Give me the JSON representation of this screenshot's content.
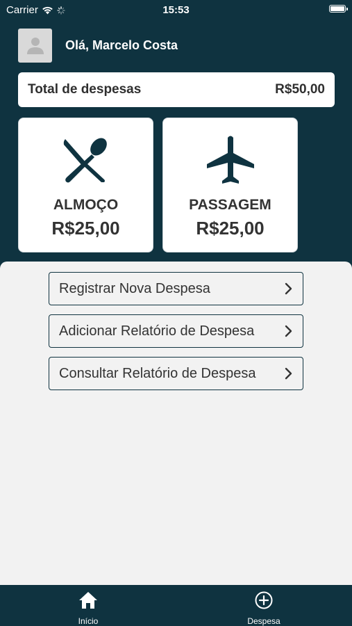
{
  "status_bar": {
    "carrier": "Carrier",
    "time": "15:53"
  },
  "header": {
    "greeting": "Olá, Marcelo Costa"
  },
  "summary": {
    "label": "Total de despesas",
    "value": "R$50,00"
  },
  "categories": [
    {
      "name": "ALMOÇO",
      "value": "R$25,00",
      "icon": "fork-knife-icon"
    },
    {
      "name": "PASSAGEM",
      "value": "R$25,00",
      "icon": "airplane-icon"
    }
  ],
  "menu": [
    {
      "label": "Registrar Nova Despesa"
    },
    {
      "label": "Adicionar Relatório de Despesa"
    },
    {
      "label": "Consultar Relatório de Despesa"
    }
  ],
  "tabs": [
    {
      "label": "Início",
      "icon": "home-icon"
    },
    {
      "label": "Despesa",
      "icon": "plus-circle-icon"
    }
  ],
  "colors": {
    "primary": "#0f3340",
    "background": "#f2f2f2",
    "card": "#ffffff"
  }
}
